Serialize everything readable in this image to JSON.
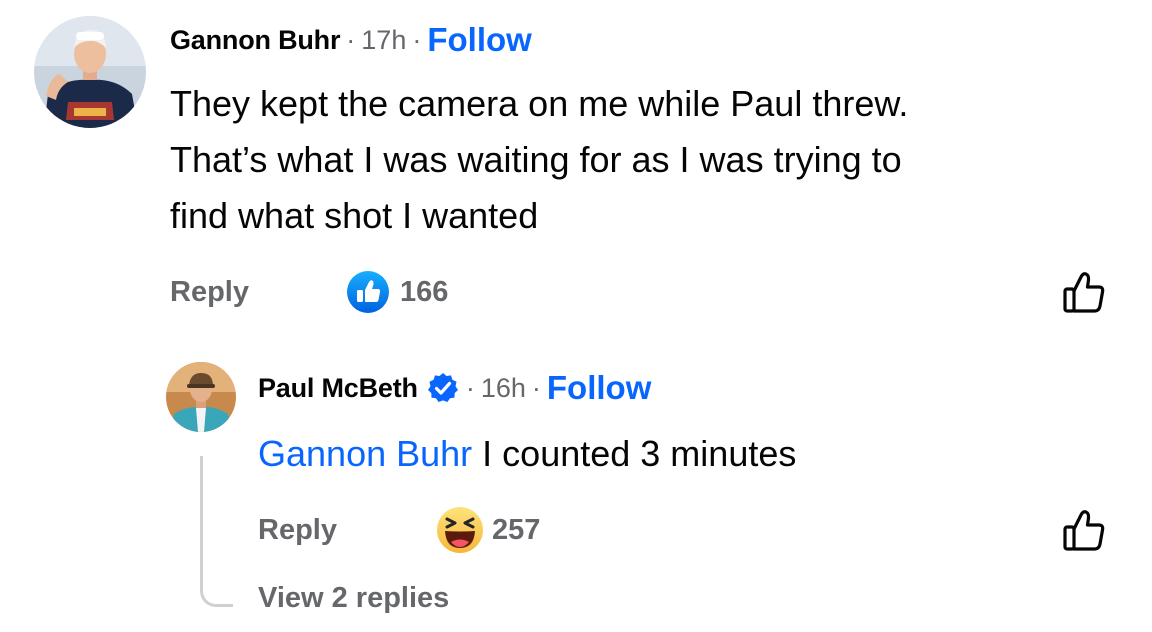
{
  "comments": [
    {
      "author": "Gannon Buhr",
      "time": "17h",
      "follow_label": "Follow",
      "text_lines": [
        "They kept the camera on me while Paul threw.",
        "That’s what I was waiting for as I was trying to",
        "find what shot I wanted"
      ],
      "reply_label": "Reply",
      "reaction": "like",
      "reaction_count": "166",
      "avatar_alt": "avatar"
    },
    {
      "author": "Paul McBeth",
      "verified": true,
      "time": "16h",
      "follow_label": "Follow",
      "mention": "Gannon Buhr",
      "text": "I counted 3 minutes",
      "reply_label": "Reply",
      "reaction": "haha",
      "reaction_count": "257",
      "view_replies_label": "View 2 replies"
    }
  ],
  "separator": "·",
  "colors": {
    "link": "#0866ff",
    "secondary_text": "#65676b",
    "primary_text": "#050505",
    "thread_line": "#ced0d4"
  },
  "icons": [
    "like-reaction-icon",
    "haha-reaction-icon",
    "like-outline-icon",
    "verified-badge-icon"
  ]
}
